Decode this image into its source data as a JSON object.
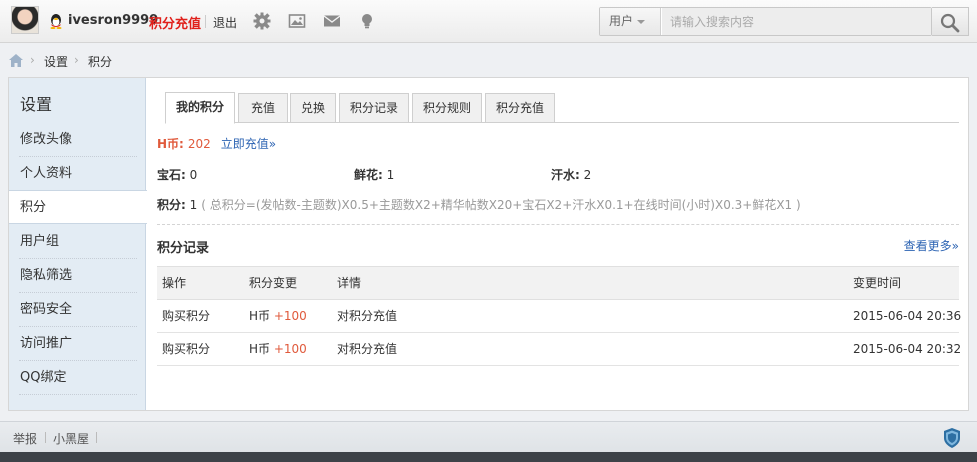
{
  "topbar": {
    "username": "ivesron9999",
    "recharge_label": "积分充值",
    "logout_label": "退出",
    "search_type": "用户",
    "search_placeholder": "请输入搜索内容"
  },
  "breadcrumb": [
    "设置",
    "积分"
  ],
  "sidebar": {
    "title": "设置",
    "items": [
      {
        "label": "修改头像",
        "active": false
      },
      {
        "label": "个人资料",
        "active": false
      },
      {
        "label": "积分",
        "active": true
      },
      {
        "label": "用户组",
        "active": false
      },
      {
        "label": "隐私筛选",
        "active": false
      },
      {
        "label": "密码安全",
        "active": false
      },
      {
        "label": "访问推广",
        "active": false
      },
      {
        "label": "QQ绑定",
        "active": false
      }
    ]
  },
  "tabs": [
    {
      "label": "我的积分",
      "active": true
    },
    {
      "label": "充值",
      "active": false
    },
    {
      "label": "兑换",
      "active": false
    },
    {
      "label": "积分记录",
      "active": false
    },
    {
      "label": "积分规则",
      "active": false
    },
    {
      "label": "积分充值",
      "active": false
    }
  ],
  "currency": {
    "label": "H币:",
    "value": "202",
    "recharge_now": "立即充值»"
  },
  "stats": [
    {
      "label": "宝石:",
      "value": "0"
    },
    {
      "label": "鲜花:",
      "value": "1"
    },
    {
      "label": "汗水:",
      "value": "2"
    }
  ],
  "score": {
    "label": "积分:",
    "value": "1",
    "formula": "( 总积分=(发帖数-主题数)X0.5+主题数X2+精华帖数X20+宝石X2+汗水X0.1+在线时间(小时)X0.3+鲜花X1 )"
  },
  "records": {
    "title": "积分记录",
    "see_more": "查看更多»",
    "headers": [
      "操作",
      "积分变更",
      "详情",
      "变更时间"
    ],
    "rows": [
      {
        "action": "购买积分",
        "unit": "H币",
        "change": "+100",
        "detail": "对积分充值",
        "time": "2015-06-04 20:36"
      },
      {
        "action": "购买积分",
        "unit": "H币",
        "change": "+100",
        "detail": "对积分充值",
        "time": "2015-06-04 20:32"
      }
    ]
  },
  "footer": {
    "links": [
      "举报",
      "小黑屋"
    ]
  },
  "colors": {
    "accent_red": "#e0201b",
    "link_blue": "#2d64b3",
    "sidebar_bg": "#e3ecf4"
  }
}
